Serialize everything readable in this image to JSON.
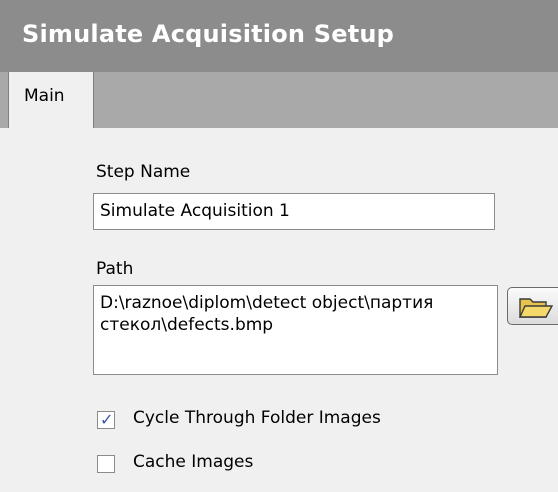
{
  "header": {
    "title": "Simulate Acquisition Setup"
  },
  "tabs": [
    {
      "label": "Main",
      "active": true
    }
  ],
  "form": {
    "step_name": {
      "label": "Step Name",
      "value": "Simulate Acquisition 1"
    },
    "path": {
      "label": "Path",
      "value": "D:\\raznoe\\diplom\\detect object\\партия\nстекол\\defects.bmp",
      "browse_icon": "folder-open-icon"
    },
    "cycle_through_folder": {
      "label": "Cycle Through Folder Images",
      "checked": true
    },
    "cache_images": {
      "label": "Cache Images",
      "checked": false
    }
  },
  "colors": {
    "header_bg": "#8c8c8c",
    "tabstrip_bg": "#a9a9a9",
    "panel_bg": "#f0f0f0",
    "check_color": "#3557a0"
  }
}
